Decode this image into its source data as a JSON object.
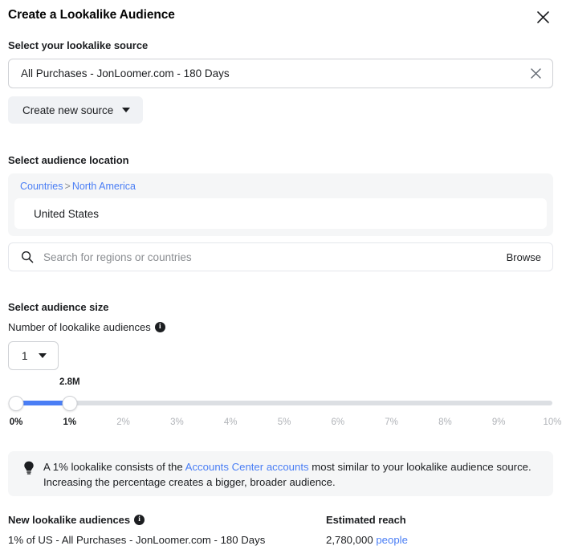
{
  "dialog": {
    "title": "Create a Lookalike Audience",
    "close_icon": "close-icon"
  },
  "source": {
    "label": "Select your lookalike source",
    "value": "All Purchases - JonLoomer.com - 180 Days",
    "clear_icon": "close-icon",
    "create_button_label": "Create new source"
  },
  "location": {
    "label": "Select audience location",
    "breadcrumb": {
      "root": "Countries",
      "separator": ">",
      "current": "North America"
    },
    "selected_region": "United States",
    "search_placeholder": "Search for regions or countries",
    "search_icon": "search-icon",
    "browse_label": "Browse"
  },
  "audience_size": {
    "label": "Select audience size",
    "count_label": "Number of lookalike audiences",
    "count_info_icon": "info-icon",
    "count_value": "1",
    "slider": {
      "bubble_label": "2.8M",
      "bubble_percent": 1,
      "min_percent": 0,
      "max_percent": 10,
      "lower_handle_percent": 0,
      "upper_handle_percent": 1,
      "fill_color": "#4a7ef5",
      "track_color": "#dcdfe3",
      "ticks": [
        {
          "label": "0%",
          "value": 0,
          "active": true
        },
        {
          "label": "1%",
          "value": 1,
          "active": true
        },
        {
          "label": "2%",
          "value": 2,
          "active": false
        },
        {
          "label": "3%",
          "value": 3,
          "active": false
        },
        {
          "label": "4%",
          "value": 4,
          "active": false
        },
        {
          "label": "5%",
          "value": 5,
          "active": false
        },
        {
          "label": "6%",
          "value": 6,
          "active": false
        },
        {
          "label": "7%",
          "value": 7,
          "active": false
        },
        {
          "label": "8%",
          "value": 8,
          "active": false
        },
        {
          "label": "9%",
          "value": 9,
          "active": false
        },
        {
          "label": "10%",
          "value": 10,
          "active": false
        }
      ]
    }
  },
  "callout": {
    "icon": "lightbulb-icon",
    "text_before": "A 1% lookalike consists of the ",
    "link": "Accounts Center accounts",
    "text_after": " most similar to your lookalike audience source. Increasing the percentage creates a bigger, broader audience."
  },
  "summary": {
    "new_audiences_title": "New lookalike audiences",
    "new_audiences_info_icon": "info-icon",
    "new_audiences_value": "1% of US - All Purchases - JonLoomer.com - 180 Days",
    "estimated_reach_title": "Estimated reach",
    "estimated_reach_value": "2,780,000",
    "estimated_reach_unit": "people"
  },
  "colors": {
    "link": "#4a7ef5",
    "panel": "#f5f6f7",
    "text": "#1c1e21"
  }
}
